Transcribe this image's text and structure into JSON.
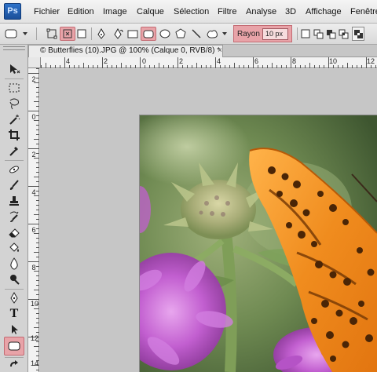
{
  "app": {
    "logo_text": "Ps"
  },
  "menu": [
    "Fichier",
    "Edition",
    "Image",
    "Calque",
    "Sélection",
    "Filtre",
    "Analyse",
    "3D",
    "Affichage",
    "Fenêtre"
  ],
  "options": {
    "rayon_label": "Rayon :",
    "rayon_value": "10 px",
    "active_shape": "rounded-rectangle",
    "active_mode": "shape-layer"
  },
  "document": {
    "tab_title": "© Butterflies (10).JPG @ 100% (Calque 0, RVB/8) *",
    "close_glyph": "×"
  },
  "ruler": {
    "h_labels": [
      "4",
      "2",
      "0",
      "2",
      "4",
      "6",
      "8",
      "10",
      "12"
    ],
    "v_labels": [
      "2",
      "0",
      "2",
      "4",
      "6",
      "8",
      "10",
      "12",
      "14"
    ]
  },
  "tools": {
    "active": "rounded-rectangle-tool",
    "text_tool_glyph": "T"
  },
  "colors": {
    "highlight": "#e8a3a8",
    "highlight_border": "#c46b73",
    "butterfly_orange": "#f08c1e",
    "flower_purple": "#c25fd0"
  }
}
